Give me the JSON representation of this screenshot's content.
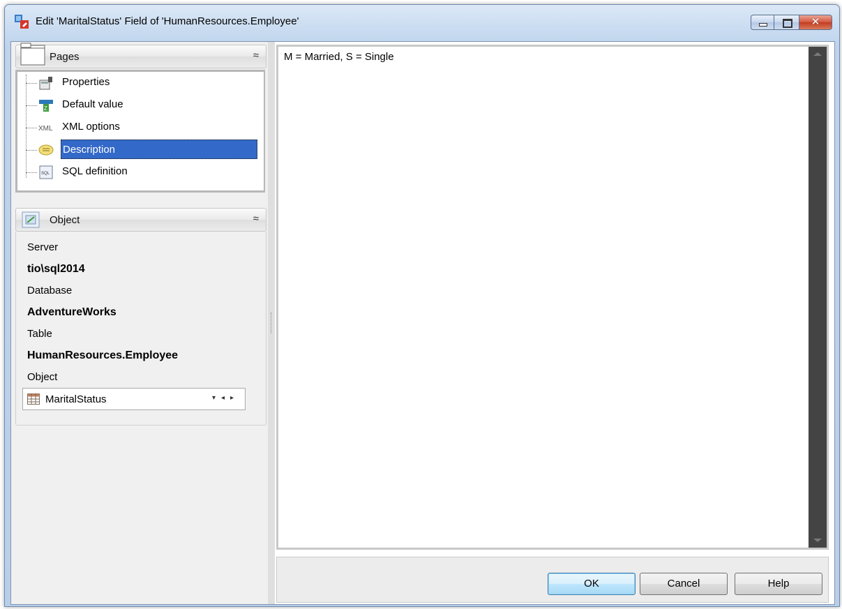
{
  "window": {
    "title": "Edit 'MaritalStatus' Field of 'HumanResources.Employee'",
    "close_glyph": "✕",
    "close_color": "#c23c20"
  },
  "pages_panel": {
    "header": "Pages",
    "collapse_glyph": "≈",
    "items": [
      {
        "label": "Properties",
        "icon": "properties-icon"
      },
      {
        "label": "Default value",
        "icon": "default-value-icon"
      },
      {
        "label": "XML options",
        "icon": "xml-icon"
      },
      {
        "label": "Description",
        "icon": "description-icon",
        "selected": true
      },
      {
        "label": "SQL definition",
        "icon": "sql-icon"
      }
    ],
    "selection_color": "#3369c8"
  },
  "object_panel": {
    "header": "Object",
    "collapse_glyph": "≈",
    "server_label": "Server",
    "server_value": "tio\\sql2014",
    "database_label": "Database",
    "database_value": "AdventureWorks",
    "table_label": "Table",
    "table_value": "HumanResources.Employee",
    "object_label": "Object",
    "object_value": "MaritalStatus",
    "combo_arrows": "▾◂▸"
  },
  "description": {
    "text": "M = Married, S = Single"
  },
  "buttons": {
    "ok": "OK",
    "cancel": "Cancel",
    "help": "Help"
  }
}
